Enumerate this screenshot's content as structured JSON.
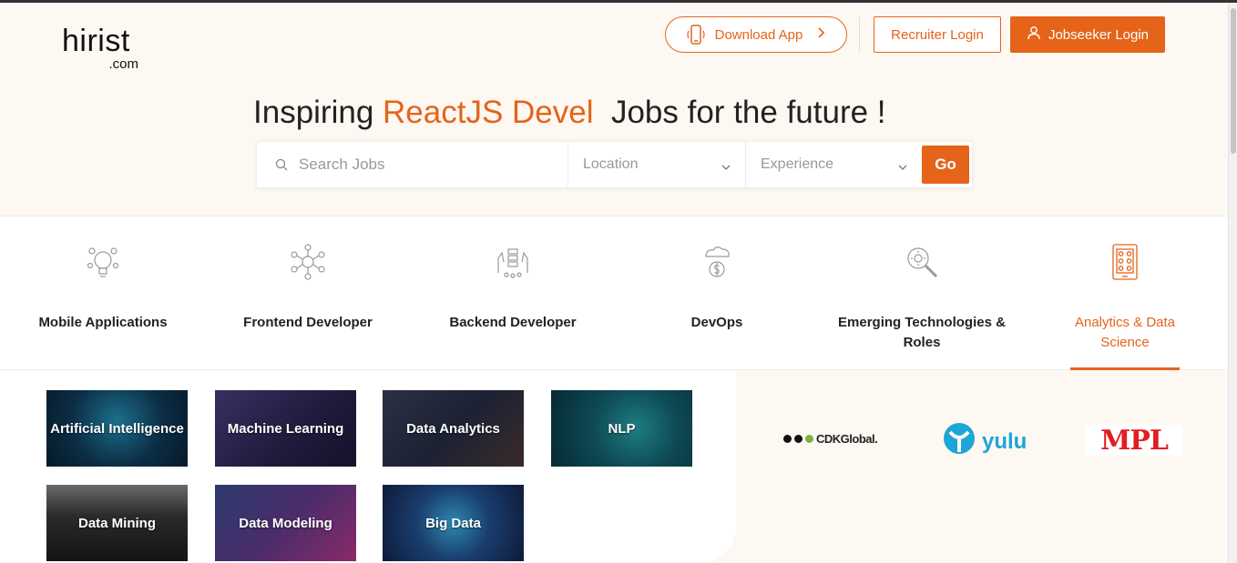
{
  "header": {
    "logo_main": "hirist",
    "logo_sub": ".com",
    "download_label": "Download App",
    "recruiter_label": "Recruiter Login",
    "jobseeker_label": "Jobseeker Login"
  },
  "hero": {
    "title_prefix": "Inspiring ",
    "title_accent": "ReactJS Devel",
    "title_suffix": "  Jobs for the future !"
  },
  "search": {
    "placeholder": "Search Jobs",
    "location_label": "Location",
    "experience_label": "Experience",
    "go_label": "Go"
  },
  "categories": [
    {
      "label": "Mobile Applications",
      "icon": "bulb-idea-icon"
    },
    {
      "label": "Frontend Developer",
      "icon": "network-nodes-icon"
    },
    {
      "label": "Backend Developer",
      "icon": "server-hands-icon"
    },
    {
      "label": "DevOps",
      "icon": "cloud-dollar-icon"
    },
    {
      "label": "Emerging Technologies & Roles",
      "icon": "magnifier-gear-icon"
    },
    {
      "label": "Analytics & Data Science",
      "icon": "tablet-analytics-icon",
      "active": true
    }
  ],
  "tiles": [
    {
      "label": "Artificial Intelligence"
    },
    {
      "label": "Machine Learning"
    },
    {
      "label": "Data Analytics"
    },
    {
      "label": "NLP"
    },
    {
      "label": "Data Mining"
    },
    {
      "label": "Data Modeling"
    },
    {
      "label": "Big Data"
    }
  ],
  "company_logos": [
    {
      "name": "CDKGlobal."
    },
    {
      "name": "yulu"
    },
    {
      "name": "MPL"
    }
  ],
  "colors": {
    "accent": "#e5641a",
    "background": "#fdf8f2"
  }
}
